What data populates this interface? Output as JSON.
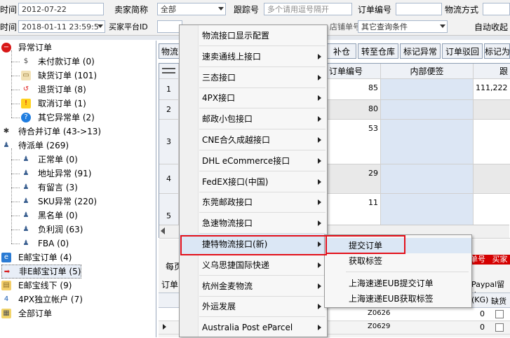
{
  "filters": {
    "time_label": "时间",
    "time_value": "2012-07-22",
    "seller_label": "卖家简称",
    "seller_value": "全部",
    "tracking_label": "跟踪号",
    "tracking_placeholder": "多个请用逗号隔开",
    "order_no_label": "订单编号",
    "logistics_label": "物流方式",
    "time2_label": "时间",
    "time2_value": "2018-01-11 23:59:5",
    "platform_id_label": "买家平台ID",
    "shop_order_label": "店铺单号",
    "shop_order_placeholder": "多个请用逗号隔开",
    "other_query_label": "其它查询条件",
    "auto_close_label": "自动收起"
  },
  "tree": {
    "items": [
      {
        "label": "异常订单",
        "icon": "minus-circle-icon",
        "level": 0
      },
      {
        "label": "未付款订单 (0)",
        "icon": "dollar-icon",
        "level": 1
      },
      {
        "label": "缺货订单 (101)",
        "icon": "box-icon",
        "level": 1
      },
      {
        "label": "退货订单 (8)",
        "icon": "return-icon",
        "level": 1
      },
      {
        "label": "取消订单 (1)",
        "icon": "warning-icon",
        "level": 1
      },
      {
        "label": "其它异常单 (2)",
        "icon": "question-icon",
        "level": 1
      },
      {
        "label": "待合并订单 (43->13)",
        "icon": "merge-icon",
        "level": 0
      },
      {
        "label": "待派单 (269)",
        "icon": "users-icon",
        "level": 0
      },
      {
        "label": "正常单 (0)",
        "icon": "user-icon",
        "level": 1
      },
      {
        "label": "地址异常 (91)",
        "icon": "user-icon",
        "level": 1
      },
      {
        "label": "有留言 (3)",
        "icon": "user-icon",
        "level": 1
      },
      {
        "label": "SKU异常 (220)",
        "icon": "user-icon",
        "level": 1
      },
      {
        "label": "黑名单 (0)",
        "icon": "user-icon",
        "level": 1
      },
      {
        "label": "负利润 (63)",
        "icon": "user-icon",
        "level": 1
      },
      {
        "label": "FBA (0)",
        "icon": "user-icon",
        "level": 1
      },
      {
        "label": "E邮宝订单 (4)",
        "icon": "e-icon",
        "level": 0
      },
      {
        "label": "非E邮宝订单 (5)",
        "icon": "arrow-right-icon",
        "level": 0
      },
      {
        "label": "E邮宝线下 (9)",
        "icon": "folder-icon",
        "level": 0
      },
      {
        "label": "4PX独立帐户 (7)",
        "icon": "4px-icon",
        "level": 0
      },
      {
        "label": "全部订单",
        "icon": "all-orders-icon",
        "level": 0
      }
    ]
  },
  "toolbar": {
    "logistics_btn": "物流",
    "restock_btn": "补仓",
    "to_warehouse_btn": "转至仓库",
    "mark_abnormal_btn": "标记异常",
    "reject_btn": "订单驳回",
    "mark_btn": "标记为"
  },
  "grid": {
    "col_order_no": "订单编号",
    "col_memo": "内部便签",
    "col_track": "跟",
    "rows": [
      {
        "num": "1",
        "order": "85",
        "memo": "",
        "track": "111,222"
      },
      {
        "num": "2",
        "order": "80",
        "memo": "",
        "track": ""
      },
      {
        "num": "3",
        "order": "53",
        "memo": "",
        "track": ""
      },
      {
        "num": "4",
        "order": "29",
        "memo": "",
        "track": ""
      },
      {
        "num": "5",
        "order": "11",
        "memo": "",
        "track": ""
      }
    ]
  },
  "lower": {
    "page_label": "每页",
    "order_label": "订单",
    "paypal_label": "Paypal留言",
    "kg_label": "(KG)",
    "missing_label": "缺货",
    "order_no_tab": "单号",
    "buyer_tab": "买家",
    "rows": [
      {
        "sku": "Z0626",
        "qty": "0"
      },
      {
        "sku": "Z0629",
        "qty": "0"
      }
    ]
  },
  "context_menu": {
    "items": [
      {
        "label": "物流接口显示配置",
        "arrow": false
      },
      {
        "label": "速卖通线上接口",
        "arrow": true
      },
      {
        "label": "三态接口",
        "arrow": true
      },
      {
        "label": "4PX接口",
        "arrow": true
      },
      {
        "label": "邮政小包接口",
        "arrow": true
      },
      {
        "label": "CNE合久成越接口",
        "arrow": true
      },
      {
        "label": "DHL eCommerce接口",
        "arrow": true
      },
      {
        "label": "FedEX接口(中国)",
        "arrow": true
      },
      {
        "label": "东莞邮政接口",
        "arrow": true
      },
      {
        "label": "急速物流接口",
        "arrow": true
      },
      {
        "label": "捷特物流接口(新)",
        "arrow": true
      },
      {
        "label": "义乌思捷国际快递",
        "arrow": true
      },
      {
        "label": "杭州金麦物流",
        "arrow": true
      },
      {
        "label": "外运发展",
        "arrow": true
      },
      {
        "label": "Australia Post eParcel",
        "arrow": true
      }
    ]
  },
  "submenu": {
    "items": [
      {
        "label": "提交订单"
      },
      {
        "label": "获取标签"
      },
      {
        "label": "上海速递EUB提交订单"
      },
      {
        "label": "上海速递EUB获取标签"
      }
    ]
  },
  "colors": {
    "highlight_red": "#e3101a",
    "menu_hover": "#dbe7f5",
    "grid_blue": "#dce6f4",
    "status_red": "#d40000"
  }
}
